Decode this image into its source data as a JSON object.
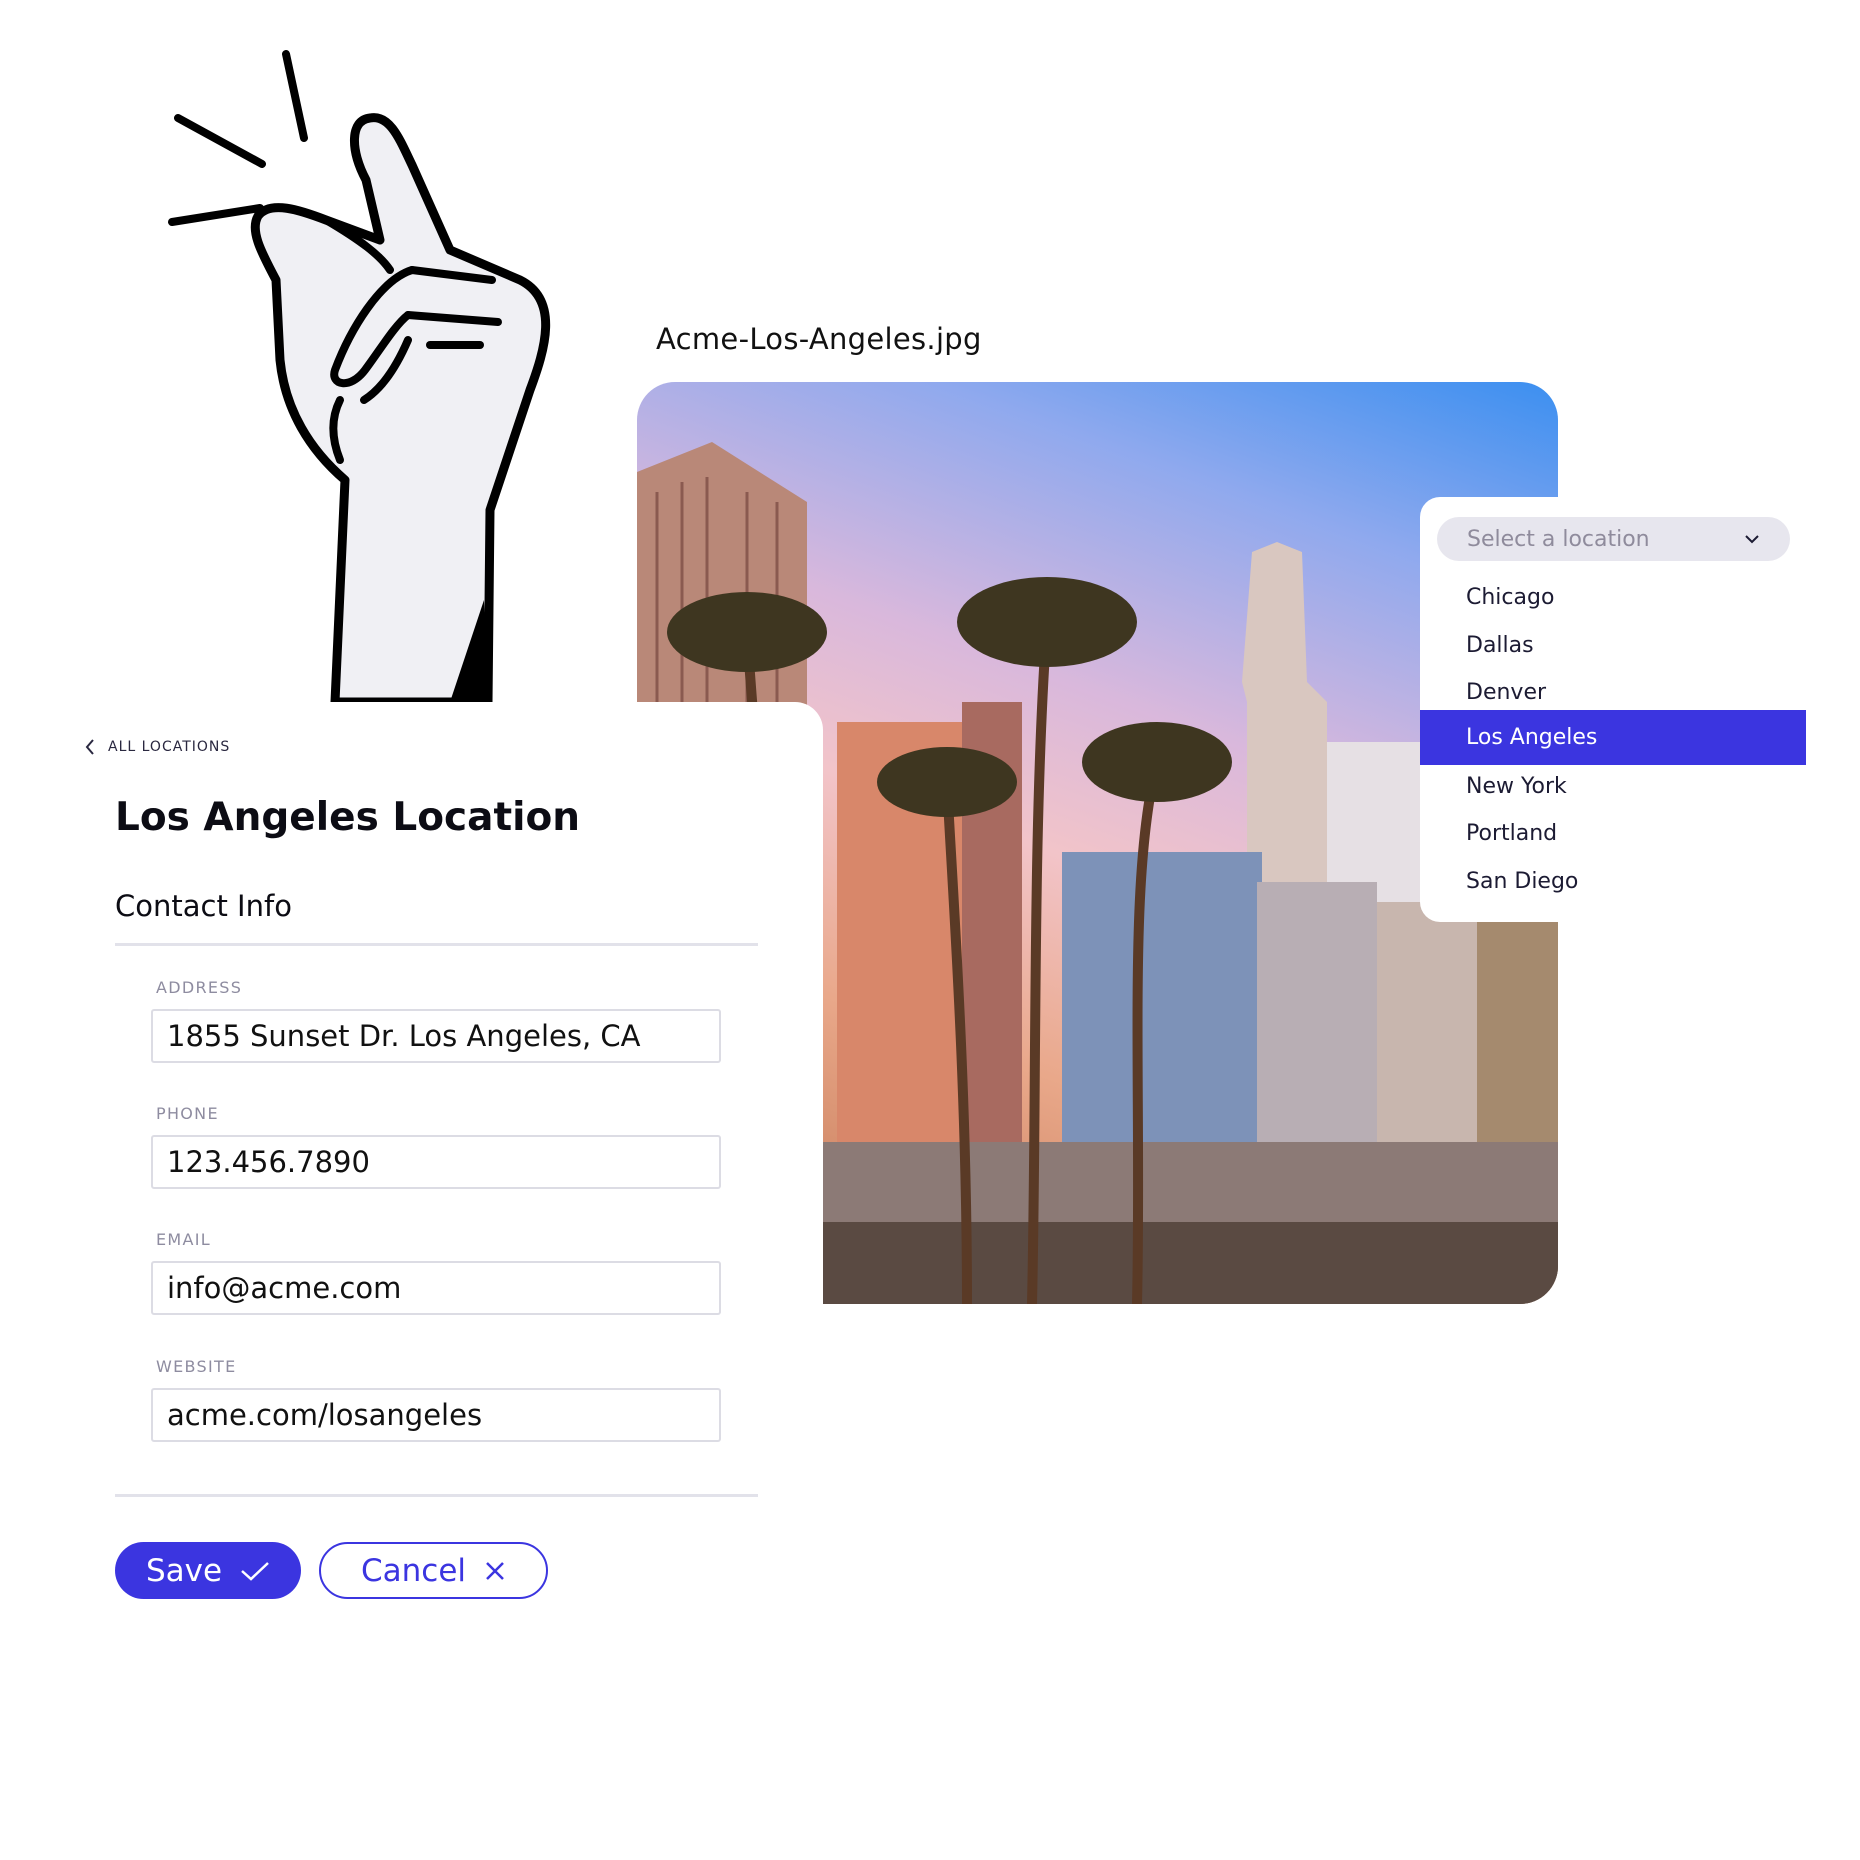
{
  "image": {
    "filename": "Acme-Los-Angeles.jpg"
  },
  "form": {
    "back_label": "ALL LOCATIONS",
    "title": "Los Angeles Location",
    "section": "Contact Info",
    "fields": [
      {
        "label": "ADDRESS",
        "value": "1855 Sunset Dr. Los Angeles, CA"
      },
      {
        "label": "PHONE",
        "value": "123.456.7890"
      },
      {
        "label": "EMAIL",
        "value": "info@acme.com"
      },
      {
        "label": "WEBSITE",
        "value": "acme.com/losangeles"
      }
    ],
    "save_label": "Save",
    "cancel_label": "Cancel"
  },
  "dropdown": {
    "placeholder": "Select a location",
    "options": [
      "Chicago",
      "Dallas",
      "Denver",
      "Los Angeles",
      "New York",
      "Portland",
      "San Diego"
    ],
    "selected": "Los Angeles"
  },
  "colors": {
    "accent": "#3b35e0",
    "input_border": "#dcdce4",
    "label": "#8e8ca0",
    "select_bg": "#e7e6ee"
  }
}
